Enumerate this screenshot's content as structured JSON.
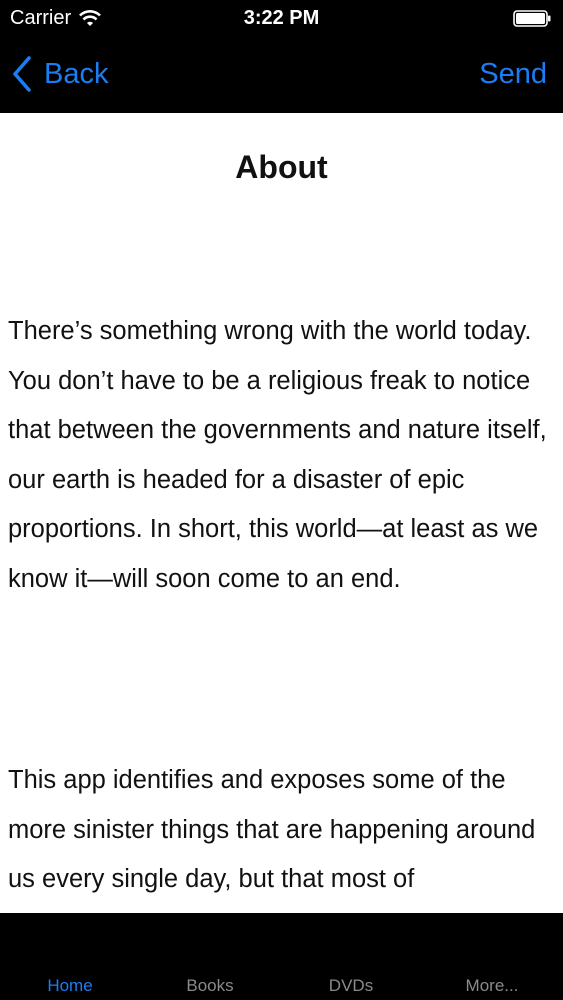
{
  "status_bar": {
    "carrier": "Carrier",
    "time": "3:22 PM"
  },
  "nav": {
    "back_label": "Back",
    "send_label": "Send"
  },
  "page": {
    "title": "About",
    "paragraphs": [
      "There’s something wrong with the world today. You don’t have to be a religious freak to notice that between the governments and nature itself, our earth is headed for a disaster of epic proportions. In short, this world—at least as we know it—will soon come to an end.",
      "This app identifies and exposes some of the more sinister things that are happening around us every single day, but that most of"
    ]
  },
  "tabs": [
    {
      "label": "Home",
      "selected": true
    },
    {
      "label": "Books",
      "selected": false
    },
    {
      "label": "DVDs",
      "selected": false
    },
    {
      "label": "More...",
      "selected": false
    }
  ],
  "colors": {
    "accent": "#1a7df3",
    "bar_background": "#000000",
    "content_background": "#ffffff",
    "inactive_tab": "#8a8a8a"
  },
  "icons": [
    "wifi-icon",
    "battery-icon",
    "chevron-left-icon"
  ]
}
